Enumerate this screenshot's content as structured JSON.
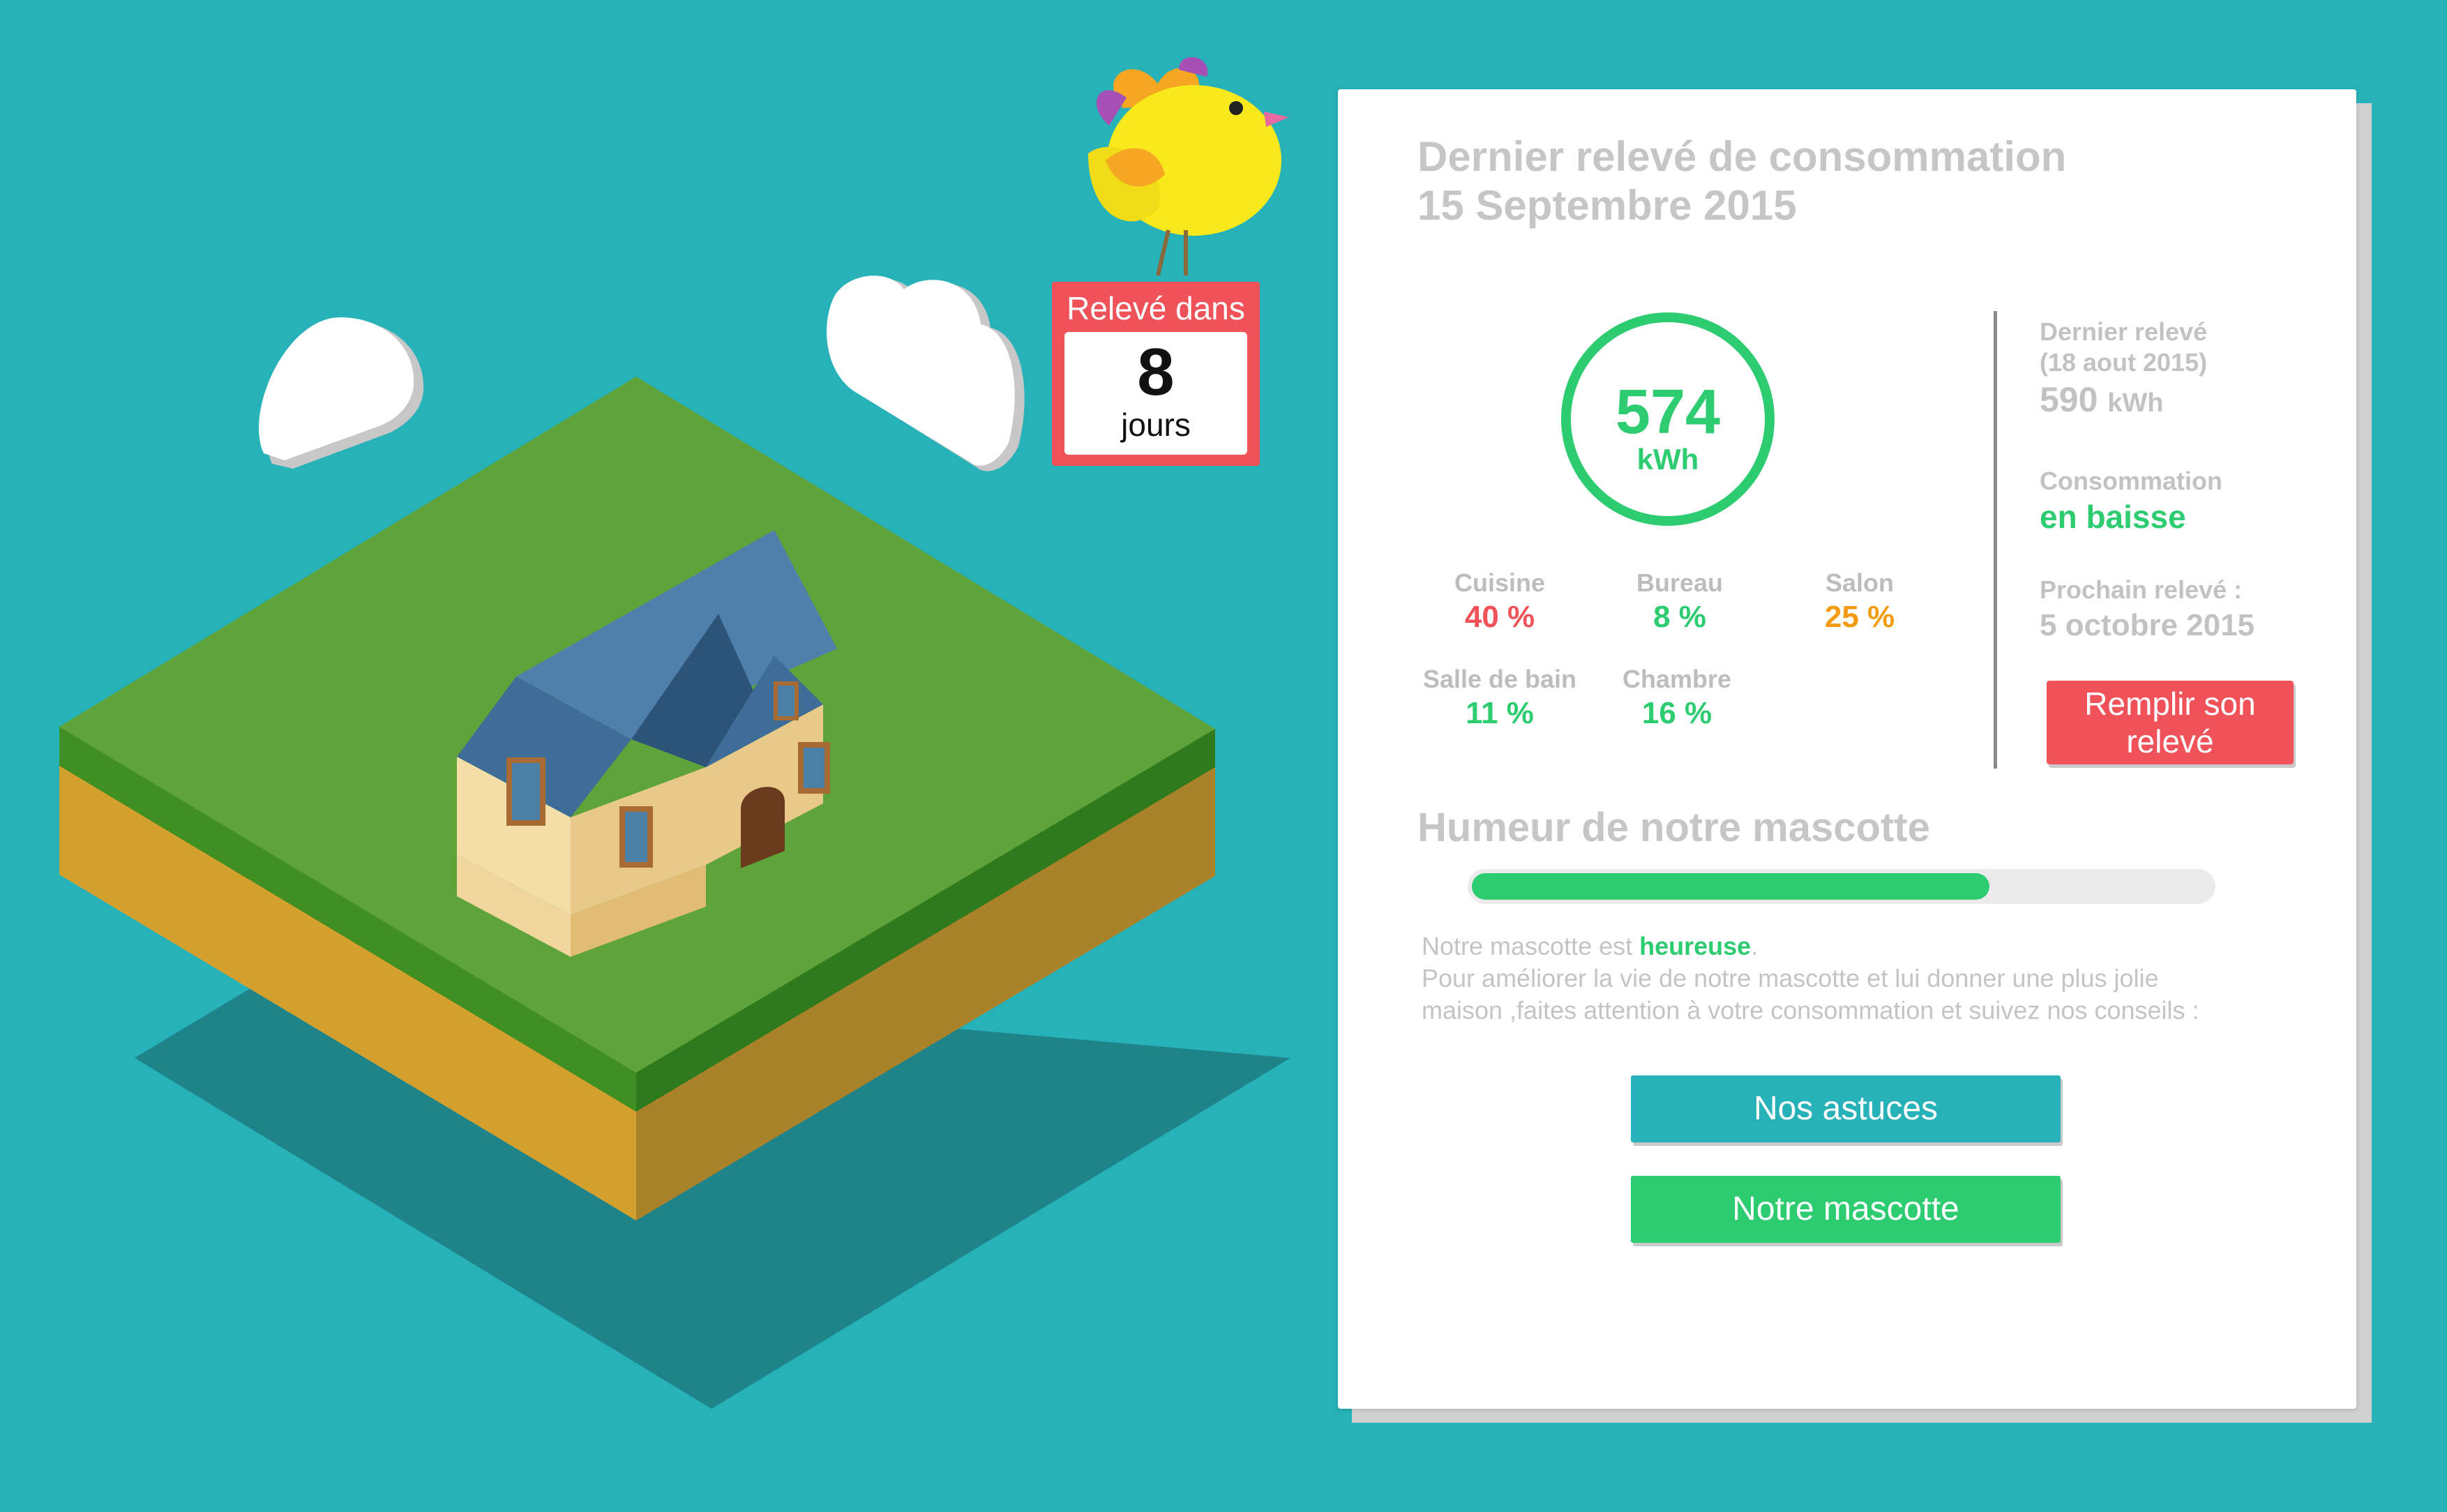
{
  "countdown": {
    "title": "Relevé dans",
    "number": "8",
    "unit": "jours"
  },
  "panel": {
    "title_line1": "Dernier relevé de consommation",
    "title_line2": "15 Septembre 2015",
    "current": {
      "value": "574",
      "unit": "kWh"
    },
    "rooms": [
      {
        "name": "Cuisine",
        "value": "40 %",
        "color": "#f0525a"
      },
      {
        "name": "Bureau",
        "value": "8 %",
        "color": "#2ecc71"
      },
      {
        "name": "Salon",
        "value": "25 %",
        "color": "#f39c12"
      },
      {
        "name": "Salle de bain",
        "value": "11 %",
        "color": "#2ecc71"
      },
      {
        "name": "Chambre",
        "value": "16 %",
        "color": "#2ecc71"
      }
    ],
    "previous": {
      "label_line1": "Dernier relevé",
      "label_line2": "(18 aout 2015)",
      "value": "590",
      "unit": "kWh"
    },
    "trend": {
      "label": "Consommation",
      "value": "en baisse"
    },
    "next": {
      "label": "Prochain relevé :",
      "date": "5 octobre 2015"
    },
    "fill_button": {
      "line1": "Remplir son",
      "line2": "relevé"
    },
    "mood": {
      "title": "Humeur de notre mascotte",
      "level": 0.7,
      "sentence_prefix": "Notre mascotte est ",
      "state": "heureuse",
      "sentence_suffix": ".",
      "advice_line1": "Pour améliorer la vie de notre mascotte et lui donner une plus jolie",
      "advice_line2": "maison ,faites attention à votre consommation et suivez nos conseils :"
    },
    "buttons": {
      "tips": "Nos astuces",
      "mascot": "Notre mascotte"
    }
  },
  "colors": {
    "background": "#27b1b9",
    "accent_green": "#2ecc71",
    "accent_red": "#f0525a",
    "accent_orange": "#f39c12"
  }
}
